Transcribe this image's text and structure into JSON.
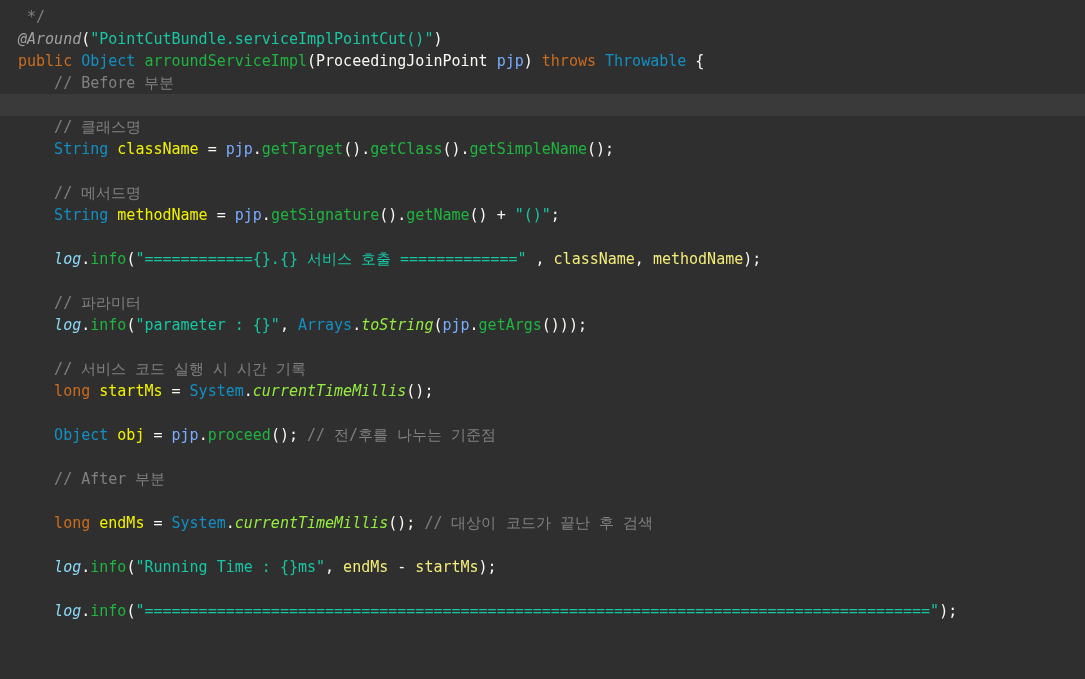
{
  "editor": {
    "lines": [
      {
        "kind": "code",
        "tokens": [
          {
            "kind": "comment",
            "text": " */"
          }
        ]
      },
      {
        "kind": "code",
        "tokens": [
          {
            "kind": "annotation",
            "text": "@Around"
          },
          {
            "kind": "plain",
            "text": "("
          },
          {
            "kind": "string",
            "text": "\"PointCutBundle.serviceImplPointCut()\""
          },
          {
            "kind": "plain",
            "text": ")"
          }
        ]
      },
      {
        "kind": "code",
        "tokens": [
          {
            "kind": "keyword",
            "text": "public"
          },
          {
            "kind": "type",
            "text": " Object"
          },
          {
            "kind": "method",
            "text": " arroundServiceImpl"
          },
          {
            "kind": "plain",
            "text": "(ProceedingJoinPoint"
          },
          {
            "kind": "param",
            "text": " pjp"
          },
          {
            "kind": "plain",
            "text": ")"
          },
          {
            "kind": "keyword",
            "text": " throws"
          },
          {
            "kind": "type",
            "text": " Throwable"
          },
          {
            "kind": "plain",
            "text": " {"
          }
        ]
      },
      {
        "kind": "code",
        "tokens": [
          {
            "kind": "comment",
            "text": "    // Before 부분"
          }
        ]
      },
      {
        "kind": "current"
      },
      {
        "kind": "code",
        "tokens": [
          {
            "kind": "comment",
            "text": "    // 클래스명"
          }
        ]
      },
      {
        "kind": "code",
        "tokens": [
          {
            "kind": "type",
            "text": "    String"
          },
          {
            "kind": "local",
            "text": " className"
          },
          {
            "kind": "plain",
            "text": " ="
          },
          {
            "kind": "param",
            "text": " pjp"
          },
          {
            "kind": "plain",
            "text": "."
          },
          {
            "kind": "method",
            "text": "getTarget"
          },
          {
            "kind": "plain",
            "text": "()."
          },
          {
            "kind": "method",
            "text": "getClass"
          },
          {
            "kind": "plain",
            "text": "()."
          },
          {
            "kind": "method",
            "text": "getSimpleName"
          },
          {
            "kind": "plain",
            "text": "();"
          }
        ]
      },
      {
        "kind": "blank"
      },
      {
        "kind": "code",
        "tokens": [
          {
            "kind": "comment",
            "text": "    // 메서드명"
          }
        ]
      },
      {
        "kind": "code",
        "tokens": [
          {
            "kind": "type",
            "text": "    String"
          },
          {
            "kind": "local",
            "text": " methodName"
          },
          {
            "kind": "plain",
            "text": " ="
          },
          {
            "kind": "param",
            "text": " pjp"
          },
          {
            "kind": "plain",
            "text": "."
          },
          {
            "kind": "method",
            "text": "getSignature"
          },
          {
            "kind": "plain",
            "text": "()."
          },
          {
            "kind": "method",
            "text": "getName"
          },
          {
            "kind": "plain",
            "text": "() +"
          },
          {
            "kind": "string",
            "text": " \"()\""
          },
          {
            "kind": "plain",
            "text": ";"
          }
        ]
      },
      {
        "kind": "blank"
      },
      {
        "kind": "code",
        "tokens": [
          {
            "kind": "field",
            "text": "    log"
          },
          {
            "kind": "plain",
            "text": "."
          },
          {
            "kind": "method",
            "text": "info"
          },
          {
            "kind": "plain",
            "text": "("
          },
          {
            "kind": "string",
            "text": "\"============{}.{} 서비스 호출 =============\""
          },
          {
            "kind": "plain",
            "text": " ,"
          },
          {
            "kind": "localref",
            "text": " className"
          },
          {
            "kind": "plain",
            "text": ","
          },
          {
            "kind": "localref",
            "text": " methodName"
          },
          {
            "kind": "plain",
            "text": ");"
          }
        ]
      },
      {
        "kind": "blank"
      },
      {
        "kind": "code",
        "tokens": [
          {
            "kind": "comment",
            "text": "    // 파라미터"
          }
        ]
      },
      {
        "kind": "code",
        "tokens": [
          {
            "kind": "field",
            "text": "    log"
          },
          {
            "kind": "plain",
            "text": "."
          },
          {
            "kind": "method",
            "text": "info"
          },
          {
            "kind": "plain",
            "text": "("
          },
          {
            "kind": "string",
            "text": "\"parameter : {}\""
          },
          {
            "kind": "plain",
            "text": ","
          },
          {
            "kind": "type",
            "text": " Arrays"
          },
          {
            "kind": "plain",
            "text": "."
          },
          {
            "kind": "static",
            "text": "toString"
          },
          {
            "kind": "plain",
            "text": "("
          },
          {
            "kind": "param",
            "text": "pjp"
          },
          {
            "kind": "plain",
            "text": "."
          },
          {
            "kind": "method",
            "text": "getArgs"
          },
          {
            "kind": "plain",
            "text": "()));"
          }
        ]
      },
      {
        "kind": "blank"
      },
      {
        "kind": "code",
        "tokens": [
          {
            "kind": "comment",
            "text": "    // 서비스 코드 실행 시 시간 기록"
          }
        ]
      },
      {
        "kind": "code",
        "tokens": [
          {
            "kind": "keyword",
            "text": "    long"
          },
          {
            "kind": "local",
            "text": " startMs"
          },
          {
            "kind": "plain",
            "text": " ="
          },
          {
            "kind": "type",
            "text": " System"
          },
          {
            "kind": "plain",
            "text": "."
          },
          {
            "kind": "static",
            "text": "currentTimeMillis"
          },
          {
            "kind": "plain",
            "text": "();"
          }
        ]
      },
      {
        "kind": "blank"
      },
      {
        "kind": "code",
        "tokens": [
          {
            "kind": "type",
            "text": "    Object"
          },
          {
            "kind": "local",
            "text": " obj"
          },
          {
            "kind": "plain",
            "text": " ="
          },
          {
            "kind": "param",
            "text": " pjp"
          },
          {
            "kind": "plain",
            "text": "."
          },
          {
            "kind": "method",
            "text": "proceed"
          },
          {
            "kind": "plain",
            "text": "();"
          },
          {
            "kind": "comment",
            "text": " // 전/후를 나누는 기준점"
          }
        ]
      },
      {
        "kind": "blank"
      },
      {
        "kind": "code",
        "tokens": [
          {
            "kind": "comment",
            "text": "    // After 부분"
          }
        ]
      },
      {
        "kind": "blank"
      },
      {
        "kind": "code",
        "tokens": [
          {
            "kind": "keyword",
            "text": "    long"
          },
          {
            "kind": "local",
            "text": " endMs"
          },
          {
            "kind": "plain",
            "text": " ="
          },
          {
            "kind": "type",
            "text": " System"
          },
          {
            "kind": "plain",
            "text": "."
          },
          {
            "kind": "static",
            "text": "currentTimeMillis"
          },
          {
            "kind": "plain",
            "text": "();"
          },
          {
            "kind": "comment",
            "text": " // 대상이 코드가 끝난 후 검색"
          }
        ]
      },
      {
        "kind": "blank"
      },
      {
        "kind": "code",
        "tokens": [
          {
            "kind": "field",
            "text": "    log"
          },
          {
            "kind": "plain",
            "text": "."
          },
          {
            "kind": "method",
            "text": "info"
          },
          {
            "kind": "plain",
            "text": "("
          },
          {
            "kind": "string",
            "text": "\"Running Time : {}ms\""
          },
          {
            "kind": "plain",
            "text": ","
          },
          {
            "kind": "localref",
            "text": " endMs"
          },
          {
            "kind": "plain",
            "text": " -"
          },
          {
            "kind": "localref",
            "text": " startMs"
          },
          {
            "kind": "plain",
            "text": ");"
          }
        ]
      },
      {
        "kind": "blank"
      },
      {
        "kind": "code",
        "tokens": [
          {
            "kind": "field",
            "text": "    log"
          },
          {
            "kind": "plain",
            "text": "."
          },
          {
            "kind": "method",
            "text": "info"
          },
          {
            "kind": "plain",
            "text": "("
          },
          {
            "kind": "string",
            "text": "\"=======================================================================================\""
          },
          {
            "kind": "plain",
            "text": ");"
          }
        ]
      }
    ]
  }
}
